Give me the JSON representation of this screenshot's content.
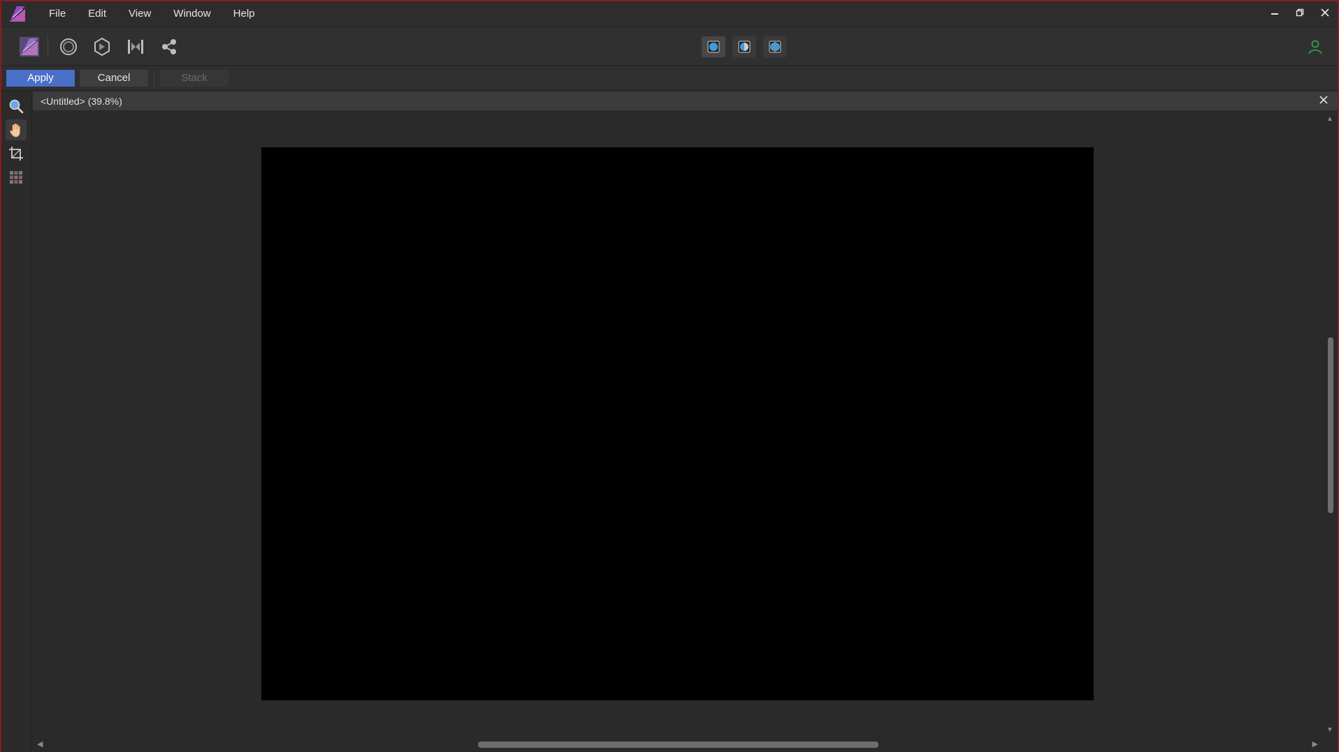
{
  "menubar": {
    "items": [
      "File",
      "Edit",
      "View",
      "Window",
      "Help"
    ]
  },
  "window_controls": {
    "minimize": "–",
    "restore": "❐",
    "close": "✕"
  },
  "toolbar": {
    "personas": [
      "photo-persona-icon",
      "liquify-persona-icon",
      "develop-persona-icon",
      "tone-mapping-persona-icon",
      "export-persona-icon"
    ],
    "modes": [
      "view-mode-normal-icon",
      "view-mode-split-icon",
      "view-mode-mirror-icon"
    ],
    "account_icon": "user-icon"
  },
  "contextbar": {
    "apply_label": "Apply",
    "cancel_label": "Cancel",
    "stack_label": "Stack"
  },
  "tools": [
    "zoom-tool-icon",
    "hand-tool-icon",
    "crop-tool-icon",
    "grid-tool-icon"
  ],
  "document": {
    "title": "<Untitled> (39.8%)",
    "close": "✕"
  },
  "colors": {
    "accent": "#4a6fc9",
    "window_border": "#8d1a1f",
    "canvas": "#000000",
    "account": "#2ea043"
  }
}
